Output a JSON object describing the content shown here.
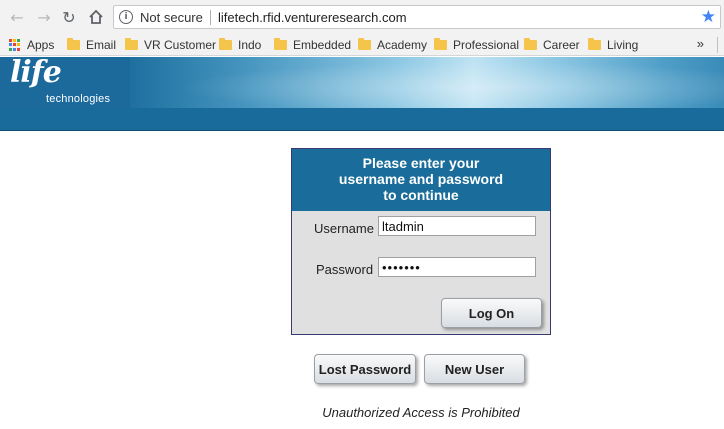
{
  "browser": {
    "security_label": "Not secure",
    "url": "lifetech.rfid.ventureresearch.com"
  },
  "bookmarks": [
    {
      "label": "Apps"
    },
    {
      "label": "Email"
    },
    {
      "label": "VR Customer"
    },
    {
      "label": "Indo"
    },
    {
      "label": "Embedded"
    },
    {
      "label": "Academy"
    },
    {
      "label": "Professional"
    },
    {
      "label": "Career"
    },
    {
      "label": "Living"
    }
  ],
  "header": {
    "logo_main": "life",
    "logo_sub": "technologies"
  },
  "login": {
    "heading_line1": "Please enter your",
    "heading_line2": "username and password",
    "heading_line3": "to continue",
    "username_label": "Username",
    "username_value": "ltadmin",
    "password_label": "Password",
    "password_value": "•••••••",
    "logon_label": "Log On"
  },
  "actions": {
    "lost_password_label": "Lost Password",
    "new_user_label": "New User"
  },
  "footer": {
    "notice": "Unauthorized Access is Prohibited"
  },
  "colors": {
    "brand_blue": "#1a6d9a",
    "panel_border": "#3a3a72",
    "star_blue": "#4285f4"
  }
}
